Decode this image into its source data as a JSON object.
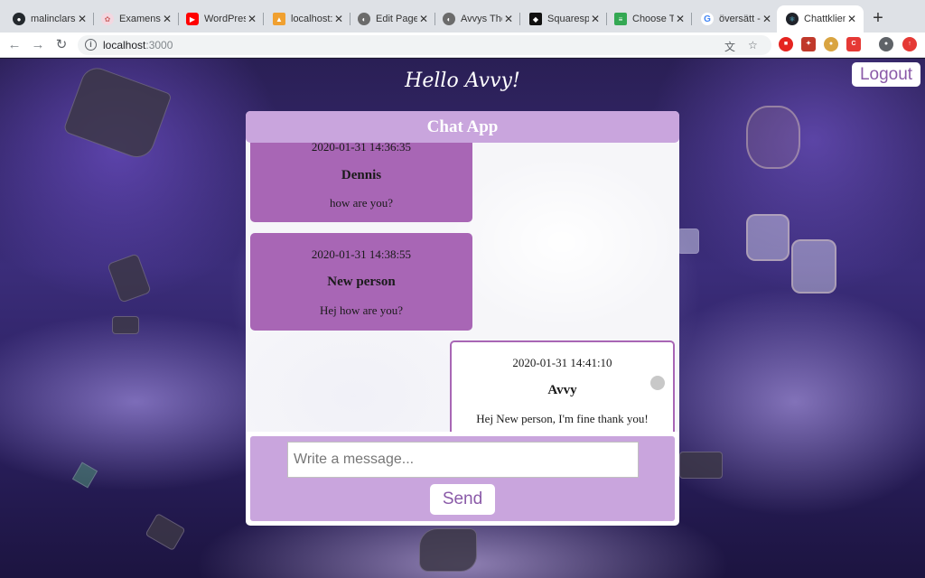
{
  "browser": {
    "tabs": [
      {
        "title": "malinclars",
        "icon": "github-icon",
        "color": "#24292e"
      },
      {
        "title": "Examensi",
        "icon": "sparkle-icon",
        "color": "#e9b4c5"
      },
      {
        "title": "WordPres",
        "icon": "youtube-icon",
        "color": "#ff0000"
      },
      {
        "title": "localhost:",
        "icon": "pma-icon",
        "color": "#f0a030"
      },
      {
        "title": "Edit Page",
        "icon": "ghost-icon",
        "color": "#6b6b6b"
      },
      {
        "title": "Avvys The",
        "icon": "ghost-icon",
        "color": "#6b6b6b"
      },
      {
        "title": "Squaresp",
        "icon": "squarespace-icon",
        "color": "#111111"
      },
      {
        "title": "Choose T",
        "icon": "sheet-icon",
        "color": "#34a853"
      },
      {
        "title": "översätt -",
        "icon": "google-icon",
        "color": "#4285f4"
      },
      {
        "title": "Chattklien",
        "icon": "react-icon",
        "color": "#20232a"
      }
    ],
    "url_host": "localhost",
    "url_port": ":3000"
  },
  "page": {
    "greeting": "Hello Avvy!",
    "logout_label": "Logout"
  },
  "chat": {
    "title": "Chat App",
    "messages": [
      {
        "time": "2020-01-31 14:36:35",
        "author": "Dennis",
        "text": "how are you?",
        "own": false
      },
      {
        "time": "2020-01-31 14:38:55",
        "author": "New person",
        "text": "Hej how are you?",
        "own": false
      },
      {
        "time": "2020-01-31 14:41:10",
        "author": "Avvy",
        "text": "Hej New person, I'm fine thank you!",
        "own": true
      }
    ],
    "input_placeholder": "Write a message...",
    "send_label": "Send"
  },
  "colors": {
    "accent": "#c9a5dd",
    "bubble_other": "#a866b5",
    "button_text": "#8a5aa8"
  }
}
